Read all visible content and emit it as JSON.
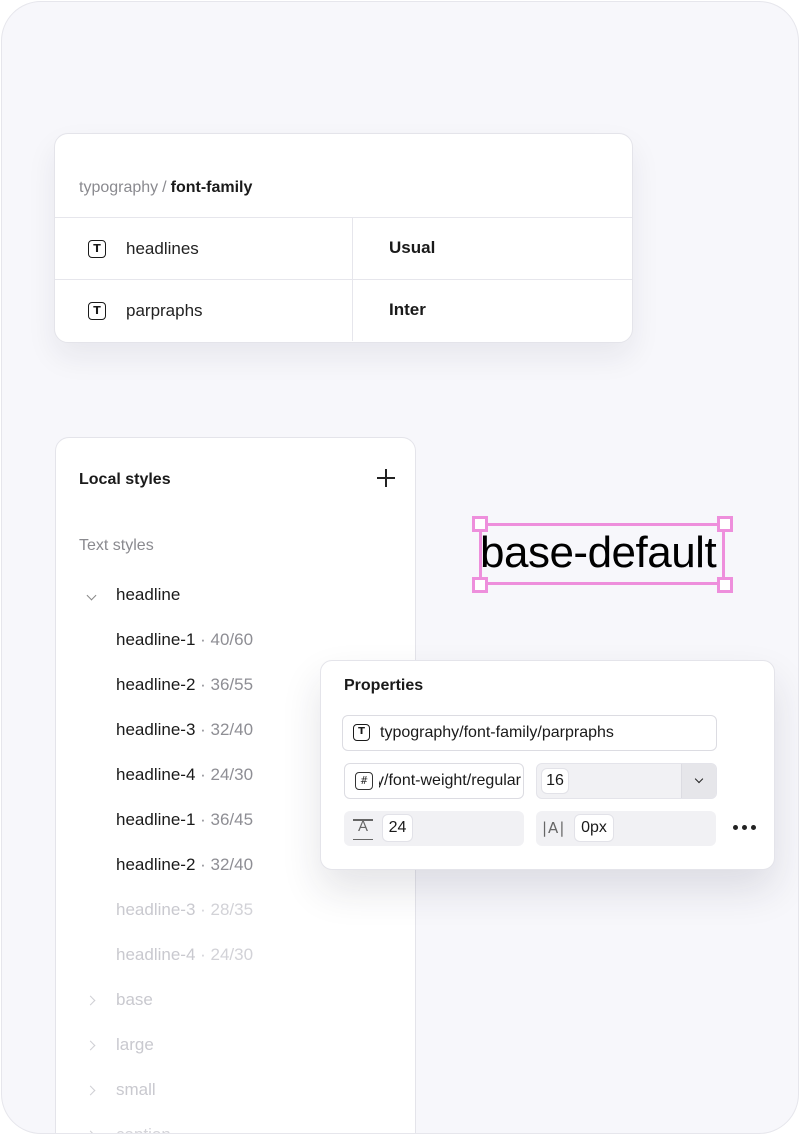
{
  "variables": {
    "breadcrumb": {
      "parent": "typography",
      "separator": "/",
      "current": "font-family"
    },
    "rows": [
      {
        "icon": "text-type-icon",
        "name": "headlines",
        "value": "Usual"
      },
      {
        "icon": "text-type-icon",
        "name": "parpraphs",
        "value": "Inter"
      }
    ]
  },
  "local_styles": {
    "title": "Local styles",
    "section": "Text styles",
    "group": "headline",
    "items": [
      {
        "name": "headline-1",
        "meta": " · 40/60"
      },
      {
        "name": "headline-2",
        "meta": " · 36/55"
      },
      {
        "name": "headline-3",
        "meta": " · 32/40"
      },
      {
        "name": "headline-4",
        "meta": " · 24/30"
      },
      {
        "name": "headline-1",
        "meta": " · 36/45"
      },
      {
        "name": "headline-2",
        "meta": " · 32/40"
      },
      {
        "name": "headline-3",
        "meta": " · 28/35"
      },
      {
        "name": "headline-4",
        "meta": " · 24/30"
      }
    ],
    "collapsed_groups": [
      "base",
      "large",
      "small",
      "caption"
    ]
  },
  "canvas": {
    "selected_text": "base-default",
    "selection_color": "#ee8fdc"
  },
  "properties": {
    "title": "Properties",
    "font_family": "typography/font-family/parpraphs",
    "font_weight": "typography/font-weight/regular",
    "font_size": "16",
    "line_height": "24",
    "letter_spacing": "0px",
    "letter_spacing_icon": "|A|"
  }
}
